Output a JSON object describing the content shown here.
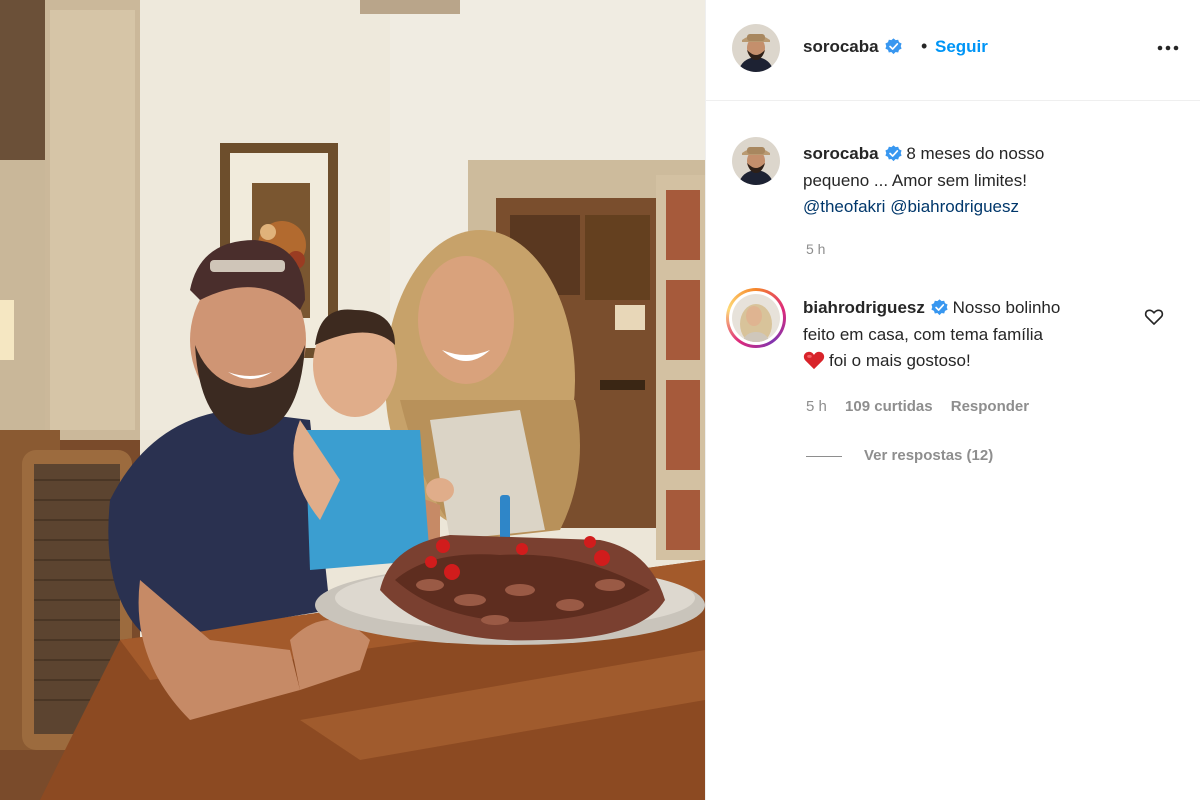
{
  "post": {
    "author": "sorocaba",
    "follow_dot": "•",
    "follow_label": "Seguir",
    "caption_lines": [
      "8 meses do nosso",
      "pequeno ... Amor sem limites!"
    ],
    "mentions": [
      "@theofakri",
      "@biahrodriguesz"
    ],
    "time": "5 h"
  },
  "comment": {
    "author": "biahrodriguesz",
    "text_start": "Nosso bolinho",
    "text_mid": "feito em casa, com tema família",
    "text_end": "foi o mais gostoso!",
    "time": "5 h",
    "likes": "109 curtidas",
    "reply_label": "Responder",
    "view_replies": "Ver respostas (12)"
  },
  "icons": {
    "verified": "verified-badge-icon",
    "more": "more-options-icon",
    "like": "heart-outline-icon",
    "emoji": "red-heart-emoji"
  },
  "colors": {
    "link": "#0095f6",
    "mention": "#00376b",
    "muted": "#8e8e8e",
    "verified": "#3897f0"
  }
}
